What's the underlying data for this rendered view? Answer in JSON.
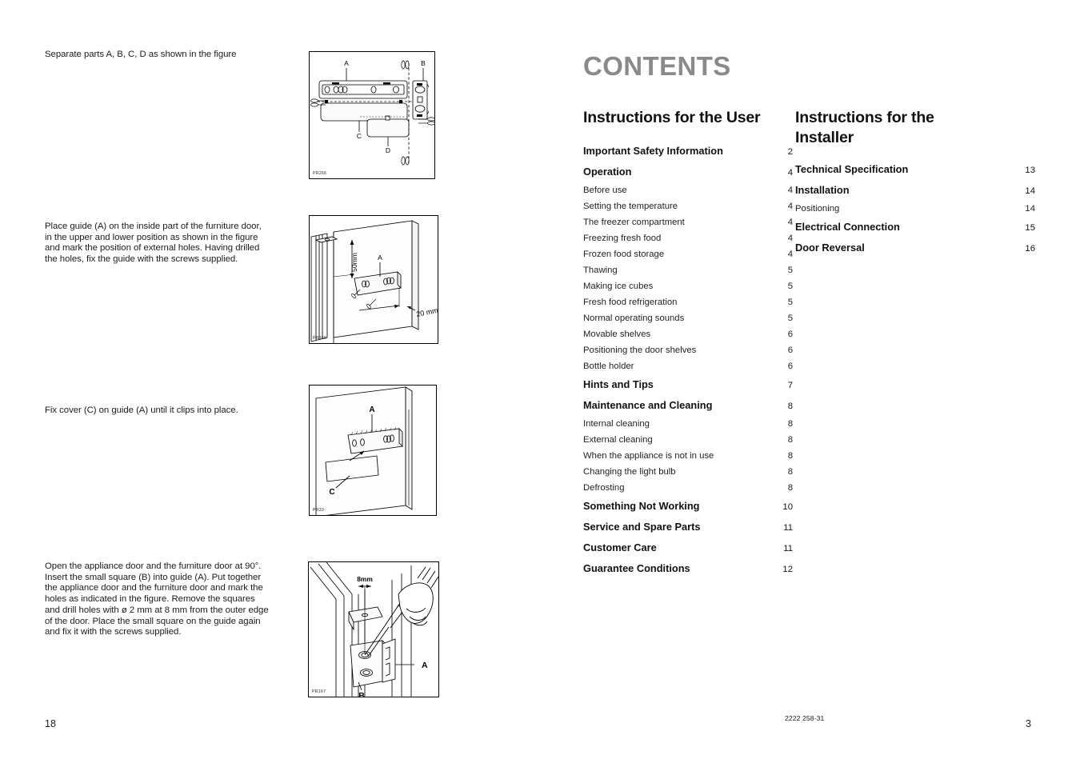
{
  "document": {
    "doc_code": "2222 258-31"
  },
  "left_page": {
    "page_number": "18",
    "steps": [
      {
        "text": "Separate parts A, B, C, D as shown in the figure",
        "figure_code": "PR266",
        "figure_labels": [
          "A",
          "B",
          "C",
          "D"
        ]
      },
      {
        "text": "Place guide (A) on the inside part of the furniture door, in the upper and lower position as shown in the figure and mark the position of external holes. Having drilled the holes, fix the guide with the screws supplied.",
        "figure_code": "PR166",
        "figure_labels": [
          "50mm",
          "A",
          "20 mm"
        ]
      },
      {
        "text": "Fix cover (C) on guide (A) until it clips into place.",
        "figure_code": "PR33",
        "figure_labels": [
          "A",
          "C"
        ]
      },
      {
        "text": "Open the appliance door and the furniture door at 90°. Insert  the small square (B) into guide (A).  Put together the appliance door and the furniture door and mark the holes as indicated in the figure. Remove the squares and drill holes with ø 2 mm at 8 mm from the outer edge of the door. Place the small square on the guide again and fix it with the screws supplied.",
        "figure_code": "PR167",
        "figure_labels": [
          "8mm",
          "A",
          "B"
        ]
      }
    ],
    "figure_text": {
      "fig1_a": "A",
      "fig1_b": "B",
      "fig1_c": "C",
      "fig1_d": "D",
      "fig2_50mm": "50mm",
      "fig2_a": "A",
      "fig2_20mm": "20 mm",
      "fig3_a": "A",
      "fig3_c": "C",
      "fig4_8mm": "8mm",
      "fig4_a": "A",
      "fig4_b": "B"
    }
  },
  "right_page": {
    "page_number": "3",
    "title": "CONTENTS",
    "title_color": "#8a8a8a",
    "columns": [
      {
        "heading": "Instructions for the User",
        "entries": [
          {
            "label": "Important Safety Information",
            "page": "2",
            "level": "major"
          },
          {
            "label": "Operation",
            "page": "4",
            "level": "major"
          },
          {
            "label": "Before use",
            "page": "4",
            "level": "minor"
          },
          {
            "label": "Setting the temperature",
            "page": "4",
            "level": "minor"
          },
          {
            "label": "The freezer compartment",
            "page": "4",
            "level": "minor"
          },
          {
            "label": "Freezing fresh food",
            "page": "4",
            "level": "minor"
          },
          {
            "label": "Frozen food storage",
            "page": "4",
            "level": "minor"
          },
          {
            "label": "Thawing",
            "page": "5",
            "level": "minor"
          },
          {
            "label": "Making ice cubes",
            "page": "5",
            "level": "minor"
          },
          {
            "label": "Fresh food refrigeration",
            "page": "5",
            "level": "minor"
          },
          {
            "label": "Normal operating sounds",
            "page": "5",
            "level": "minor"
          },
          {
            "label": "Movable shelves",
            "page": "6",
            "level": "minor"
          },
          {
            "label": "Positioning the door shelves",
            "page": "6",
            "level": "minor"
          },
          {
            "label": "Bottle holder",
            "page": "6",
            "level": "minor"
          },
          {
            "label": "Hints and Tips",
            "page": "7",
            "level": "major"
          },
          {
            "label": "Maintenance and Cleaning",
            "page": "8",
            "level": "major"
          },
          {
            "label": "Internal cleaning",
            "page": "8",
            "level": "minor"
          },
          {
            "label": "External cleaning",
            "page": "8",
            "level": "minor"
          },
          {
            "label": "When the appliance is not in use",
            "page": "8",
            "level": "minor"
          },
          {
            "label": "Changing the light bulb",
            "page": "8",
            "level": "minor"
          },
          {
            "label": "Defrosting",
            "page": "8",
            "level": "minor"
          },
          {
            "label": "Something Not Working",
            "page": "10",
            "level": "major"
          },
          {
            "label": "Service and Spare Parts",
            "page": "11",
            "level": "major"
          },
          {
            "label": "Customer Care",
            "page": "11",
            "level": "major"
          },
          {
            "label": "Guarantee Conditions",
            "page": "12",
            "level": "major"
          }
        ]
      },
      {
        "heading": "Instructions for the Installer",
        "entries": [
          {
            "label": "Technical Specification",
            "page": "13",
            "level": "major"
          },
          {
            "label": "Installation",
            "page": "14",
            "level": "major"
          },
          {
            "label": "Positioning",
            "page": "14",
            "level": "minor"
          },
          {
            "label": "Electrical Connection",
            "page": "15",
            "level": "major"
          },
          {
            "label": "Door Reversal",
            "page": "16",
            "level": "major"
          }
        ]
      }
    ]
  }
}
